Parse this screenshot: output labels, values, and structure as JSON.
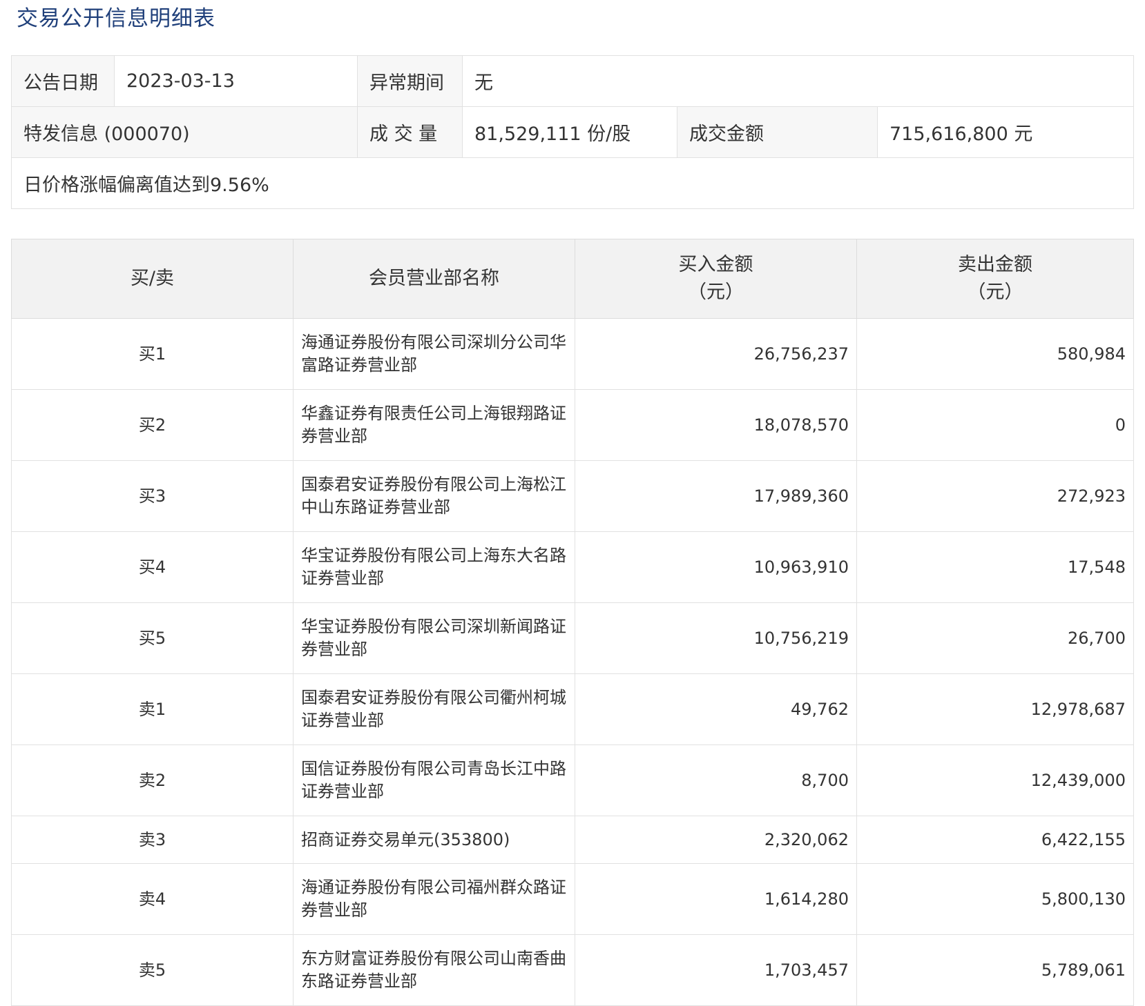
{
  "page": {
    "title": "交易公开信息明细表"
  },
  "summary": {
    "announce_date_label": "公告日期",
    "announce_date_value": "2023-03-13",
    "abnormal_period_label": "异常期间",
    "abnormal_period_value": "无",
    "special_info_label": "特发信息 (000070)",
    "volume_label": "成 交 量",
    "volume_value": "81,529,111 份/股",
    "amount_label": "成交金额",
    "amount_value": "715,616,800 元",
    "reason": "日价格涨幅偏离值达到9.56%"
  },
  "detail": {
    "headers": {
      "side": "买/卖",
      "member": "会员营业部名称",
      "buy_line1": "买入金额",
      "buy_line2": "（元）",
      "sell_line1": "卖出金额",
      "sell_line2": "（元）"
    },
    "rows": [
      {
        "side": "买1",
        "member": "海通证券股份有限公司深圳分公司华富路证券营业部",
        "buy": "26,756,237",
        "sell": "580,984"
      },
      {
        "side": "买2",
        "member": "华鑫证券有限责任公司上海银翔路证券营业部",
        "buy": "18,078,570",
        "sell": "0"
      },
      {
        "side": "买3",
        "member": "国泰君安证券股份有限公司上海松江中山东路证券营业部",
        "buy": "17,989,360",
        "sell": "272,923"
      },
      {
        "side": "买4",
        "member": "华宝证券股份有限公司上海东大名路证券营业部",
        "buy": "10,963,910",
        "sell": "17,548"
      },
      {
        "side": "买5",
        "member": "华宝证券股份有限公司深圳新闻路证券营业部",
        "buy": "10,756,219",
        "sell": "26,700"
      },
      {
        "side": "卖1",
        "member": "国泰君安证券股份有限公司衢州柯城证券营业部",
        "buy": "49,762",
        "sell": "12,978,687"
      },
      {
        "side": "卖2",
        "member": "国信证券股份有限公司青岛长江中路证券营业部",
        "buy": "8,700",
        "sell": "12,439,000"
      },
      {
        "side": "卖3",
        "member": "招商证券交易单元(353800)",
        "buy": "2,320,062",
        "sell": "6,422,155"
      },
      {
        "side": "卖4",
        "member": "海通证券股份有限公司福州群众路证券营业部",
        "buy": "1,614,280",
        "sell": "5,800,130"
      },
      {
        "side": "卖5",
        "member": "东方财富证券股份有限公司山南香曲东路证券营业部",
        "buy": "1,703,457",
        "sell": "5,789,061"
      }
    ]
  }
}
